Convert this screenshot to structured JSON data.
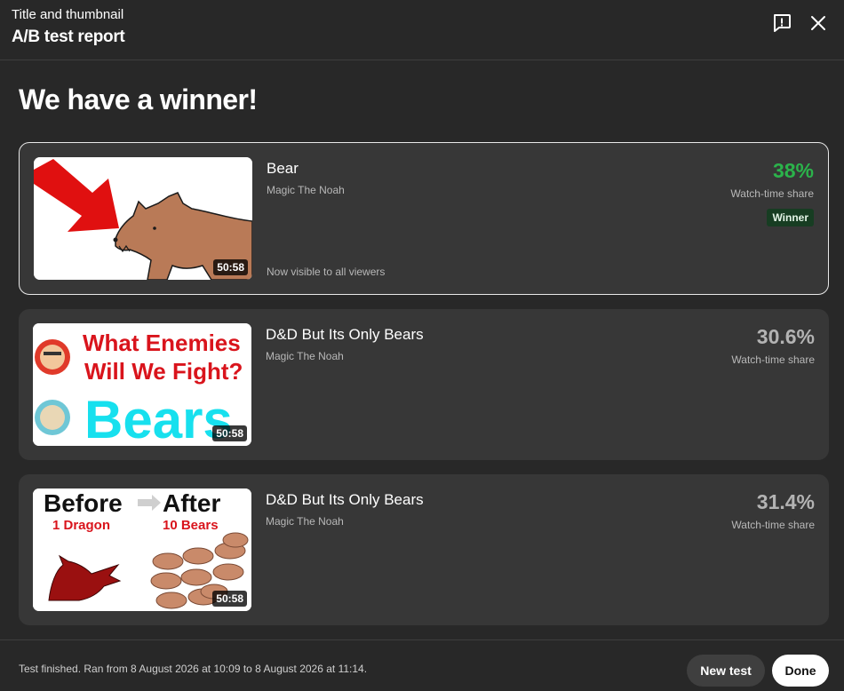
{
  "header": {
    "subtitle": "Title and thumbnail",
    "title": "A/B test report",
    "feedback_icon": "feedback-icon",
    "close_icon": "close-icon"
  },
  "headline": "We have a winner!",
  "variants": [
    {
      "title": "Bear",
      "channel": "Magic The Noah",
      "duration": "50:58",
      "share": "38%",
      "share_label": "Watch-time share",
      "badge": "Winner",
      "note": "Now visible to all viewers",
      "thumbnail": "red-arrow-pointing-at-cartoon-bear"
    },
    {
      "title": "D&D But Its Only Bears",
      "channel": "Magic The Noah",
      "duration": "50:58",
      "share": "30.6%",
      "share_label": "Watch-time share",
      "thumbnail_text": {
        "line1": "What Enemies",
        "line2": "Will We Fight?",
        "big": "Bears"
      }
    },
    {
      "title": "D&D But Its Only Bears",
      "channel": "Magic The Noah",
      "duration": "50:58",
      "share": "31.4%",
      "share_label": "Watch-time share",
      "thumbnail_text": {
        "before": "Before",
        "after": "After",
        "left_sub": "1 Dragon",
        "right_sub": "10 Bears"
      }
    }
  ],
  "footer": {
    "status": "Test finished. Ran from 8 August 2026 at 10:09 to 8 August 2026 at 11:14.",
    "new_test_label": "New test",
    "done_label": "Done"
  },
  "colors": {
    "background": "#282828",
    "card": "#373737",
    "winner_green": "#2bb34b",
    "thumb_red": "#d9141c",
    "thumb_cyan": "#17e0ee",
    "bear_brown": "#b97a57"
  }
}
